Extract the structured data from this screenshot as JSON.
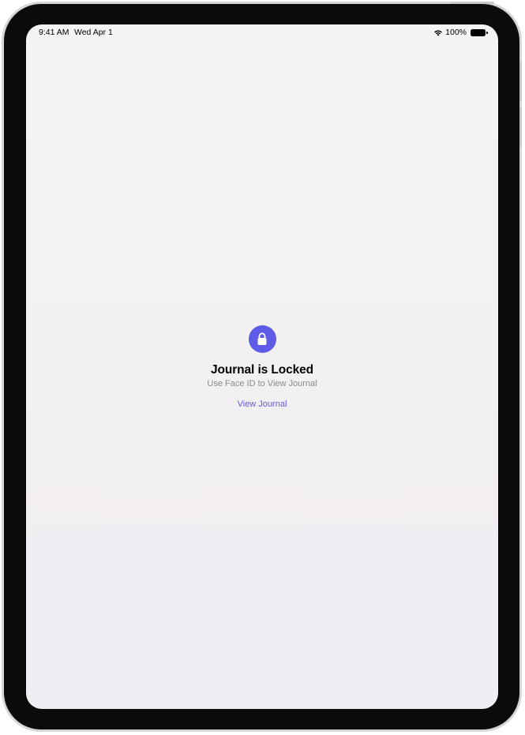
{
  "status_bar": {
    "time": "9:41 AM",
    "date": "Wed Apr 1",
    "battery": "100%"
  },
  "lock_screen": {
    "icon": "lock-icon",
    "title": "Journal is Locked",
    "subtitle": "Use Face ID to View Journal",
    "action_label": "View Journal"
  },
  "colors": {
    "accent": "#5e5ce6",
    "background": "#f4f2f3",
    "subtitle": "#8a8a8e"
  }
}
